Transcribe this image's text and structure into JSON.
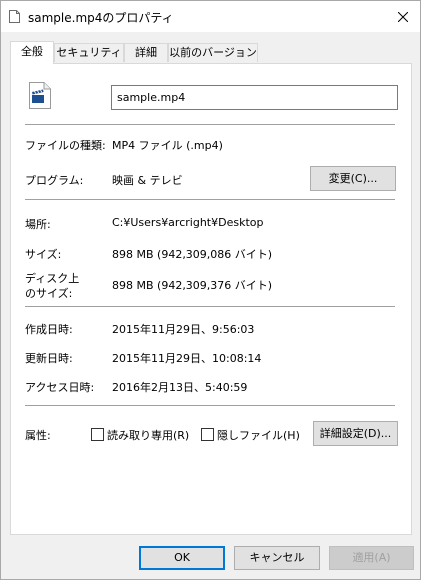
{
  "window": {
    "title": "sample.mp4のプロパティ",
    "close_glyph": "✕"
  },
  "tabs": [
    {
      "label": "全般",
      "active": true
    },
    {
      "label": "セキュリティ",
      "active": false
    },
    {
      "label": "詳細",
      "active": false
    },
    {
      "label": "以前のバージョン",
      "active": false
    }
  ],
  "general": {
    "filename": "sample.mp4",
    "file_type_label": "ファイルの種類:",
    "file_type_value": "MP4 ファイル (.mp4)",
    "program_label": "プログラム:",
    "program_value": "映画 & テレビ",
    "change_button": "変更(C)...",
    "location_label": "場所:",
    "location_value": "C:¥Users¥arcright¥Desktop",
    "size_label": "サイズ:",
    "size_value": "898 MB (942,309,086 バイト)",
    "disk_size_label_1": "ディスク上",
    "disk_size_label_2": "のサイズ:",
    "disk_size_value": "898 MB (942,309,376 バイト)",
    "created_label": "作成日時:",
    "created_value": "2015年11月29日、9:56:03",
    "modified_label": "更新日時:",
    "modified_value": "2015年11月29日、10:08:14",
    "accessed_label": "アクセス日時:",
    "accessed_value": "2016年2月13日、5:40:59",
    "attributes_label": "属性:",
    "readonly_label": "読み取り専用(R)",
    "readonly_checked": false,
    "hidden_label": "隠しファイル(H)",
    "hidden_checked": false,
    "advanced_button": "詳細設定(D)..."
  },
  "footer": {
    "ok": "OK",
    "cancel": "キャンセル",
    "apply": "適用(A)"
  },
  "colors": {
    "accent": "#0078d7",
    "file_icon": "#1e4f91"
  }
}
